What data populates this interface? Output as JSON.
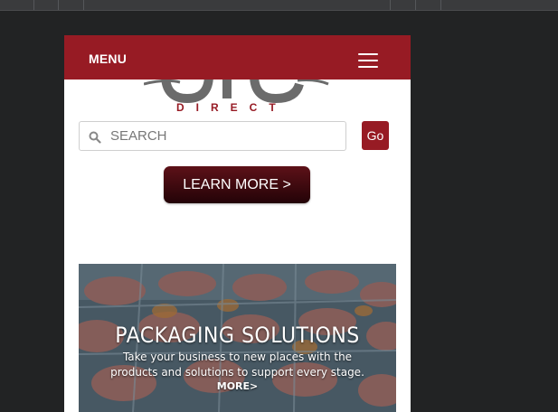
{
  "header": {
    "menu_label": "MENU"
  },
  "logo": {
    "tagline": "DIRECT"
  },
  "search": {
    "placeholder": "SEARCH",
    "go_label": "Go"
  },
  "cta": {
    "learn_more_label": "LEARN MORE >"
  },
  "banner": {
    "title": "PACKAGING SOLUTIONS",
    "line1": "Take your business to new places with the",
    "line2": "products and solutions to support every stage.",
    "more_label": "MORE>"
  },
  "colors": {
    "brand_red": "#971b24",
    "page_background": "#222324",
    "button_dark": "#3d0a10"
  }
}
